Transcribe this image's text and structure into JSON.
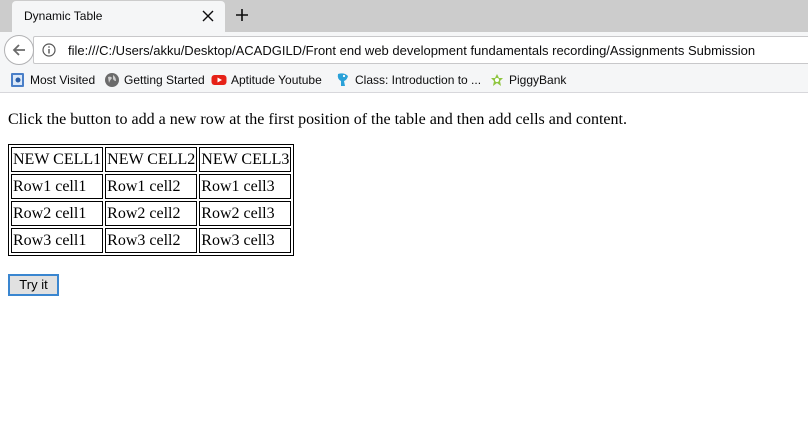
{
  "browser": {
    "tab": {
      "title": "Dynamic Table"
    },
    "url": "file:///C:/Users/akku/Desktop/ACADGILD/Front end web development fundamentals recording/Assignments Submission",
    "bookmarks": [
      {
        "label": "Most Visited",
        "icon": "most-visited-icon"
      },
      {
        "label": "Getting Started",
        "icon": "globe-icon"
      },
      {
        "label": "Aptitude Youtube",
        "icon": "youtube-icon"
      },
      {
        "label": "Class: Introduction to ...",
        "icon": "tux-icon"
      },
      {
        "label": "PiggyBank",
        "icon": "piggybank-icon"
      }
    ]
  },
  "page": {
    "intro": "Click the button to add a new row at the first position of the table and then add cells and content.",
    "table": {
      "rows": [
        [
          "NEW CELL1",
          "NEW CELL2",
          "NEW CELL3"
        ],
        [
          "Row1 cell1",
          "Row1 cell2",
          "Row1 cell3"
        ],
        [
          "Row2 cell1",
          "Row2 cell2",
          "Row2 cell3"
        ],
        [
          "Row3 cell1",
          "Row3 cell2",
          "Row3 cell3"
        ]
      ]
    },
    "button_label": "Try it"
  }
}
